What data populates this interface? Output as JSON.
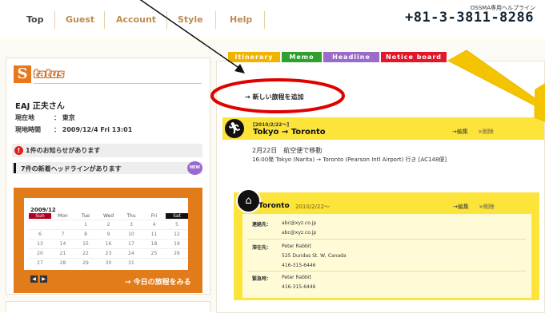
{
  "nav": {
    "items": [
      {
        "label": "Top",
        "active": true
      },
      {
        "label": "Guest",
        "active": false
      },
      {
        "label": "Account",
        "active": false
      },
      {
        "label": "Style",
        "active": false
      },
      {
        "label": "Help",
        "active": false
      }
    ],
    "helpline_caption": "OSSMA専用ヘルプライン",
    "helpline_number": "+81-3-3811-8286"
  },
  "status": {
    "logo_letter": "S",
    "logo_word": "tatus",
    "user_name": "EAJ 正夫さん",
    "location_label": "現在地",
    "location_value": "： 東京",
    "time_label": "現地時間",
    "time_value": "： 2009/12/4 Fri 13:01",
    "notice_icon": "!",
    "notice_text": "1件のお知らせがあります",
    "headline_text": "7件の新着ヘッドラインがあります",
    "new_badge": "NEW"
  },
  "calendar": {
    "month": "2009/12",
    "weekdays": [
      "Sun",
      "Mon",
      "Tue",
      "Wed",
      "Thu",
      "Fri",
      "Sat"
    ],
    "weeks": [
      [
        "",
        "",
        "1",
        "2",
        "3",
        "4",
        "5"
      ],
      [
        "6",
        "7",
        "8",
        "9",
        "10",
        "11",
        "12"
      ],
      [
        "13",
        "14",
        "15",
        "16",
        "17",
        "18",
        "19"
      ],
      [
        "20",
        "21",
        "22",
        "23",
        "24",
        "25",
        "26"
      ],
      [
        "27",
        "28",
        "29",
        "30",
        "31",
        "",
        ""
      ]
    ],
    "prev_label": "◀",
    "next_label": "▶",
    "today_link": "→ 今日の旅程をみる"
  },
  "tabs": [
    {
      "label": "Itinerary",
      "color": "#f0b400",
      "active": true
    },
    {
      "label": "Memo",
      "color": "#2da02d",
      "active": false
    },
    {
      "label": "Headline",
      "color": "#9b6bc9",
      "active": false
    },
    {
      "label": "Notice board",
      "color": "#e2182a",
      "active": false
    }
  ],
  "main": {
    "add_itinerary": "→ 新しい旅程を追加",
    "itinerary1": {
      "date": "[2010/2/22〜]",
      "title": "Tokyo → Toronto",
      "edit": "→編集",
      "delete": "×削除",
      "desc1": "2月22日　航空便で移動",
      "desc2": "16:00発 Tokyo (Narita) → Toronto (Pearson Intl Airport) 行き [AC148便]"
    },
    "itinerary2": {
      "name": "Toronto",
      "date": "2010/2/22〜",
      "edit": "→編集",
      "delete": "×削除",
      "contact_label": "連絡先：",
      "contact_lines": [
        "abc@xyz.co.jp",
        "abc@xyz.co.jp"
      ],
      "stay_label": "滞在先：",
      "stay_lines": [
        "Peter Rabbit",
        "525 Dundas St. W, Canada",
        "416-315-6446"
      ],
      "emergency_label": "緊急時：",
      "emergency_lines": [
        "Peter Rabbit",
        "416-315-6446"
      ]
    }
  }
}
